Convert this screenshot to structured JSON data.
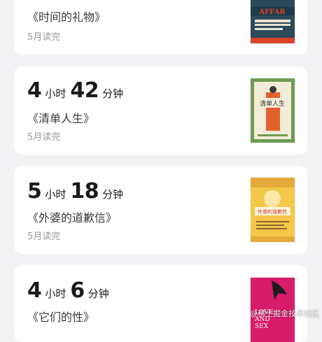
{
  "records": [
    {
      "title": "《时间的礼物》",
      "date": "5月读完",
      "cover": {
        "lines": [
          "AFFAR"
        ],
        "bg": "#2c4a5a",
        "accent": "#d8432a"
      }
    },
    {
      "hours": "4",
      "hours_unit": "小时",
      "minutes": "42",
      "minutes_unit": "分钟",
      "title": "《清单人生》",
      "date": "5月读完",
      "cover": {
        "lines": [
          "清单人生"
        ],
        "bg": "#6f9a52",
        "accent": "#e2622d"
      }
    },
    {
      "hours": "5",
      "hours_unit": "小时",
      "minutes": "18",
      "minutes_unit": "分钟",
      "title": "《外婆的道歉信》",
      "date": "5月读完",
      "cover": {
        "lines": [
          "外婆的道歉信"
        ],
        "bg": "#f4c64a",
        "accent": "#c4322a"
      }
    },
    {
      "hours": "4",
      "hours_unit": "小时",
      "minutes": "6",
      "minutes_unit": "分钟",
      "title": "《它们的性》",
      "cover": {
        "lines": [
          "LOVE",
          "AND",
          "SEX"
        ],
        "bg": "#d81b6a",
        "accent": "#1d1d1d"
      }
    }
  ],
  "watermark": "@稀土掘金技术社区"
}
